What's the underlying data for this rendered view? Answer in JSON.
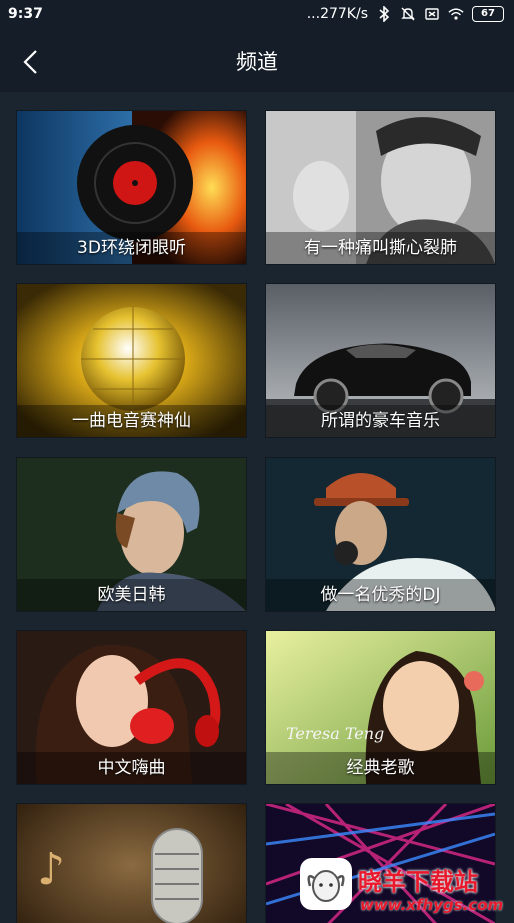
{
  "status": {
    "time": "9:37",
    "net_speed": "...277K/s",
    "battery": "67"
  },
  "header": {
    "title": "频道"
  },
  "channels": [
    {
      "label": "3D环绕闭眼听"
    },
    {
      "label": "有一种痛叫撕心裂肺"
    },
    {
      "label": "一曲电音赛神仙"
    },
    {
      "label": "所谓的豪车音乐"
    },
    {
      "label": "欧美日韩"
    },
    {
      "label": "做一名优秀的DJ"
    },
    {
      "label": "中文嗨曲"
    },
    {
      "label": "经典老歌"
    },
    {
      "label": ""
    },
    {
      "label": ""
    }
  ],
  "watermark": {
    "text": "晓羊下载站",
    "url": "www.xfhygs.com"
  }
}
